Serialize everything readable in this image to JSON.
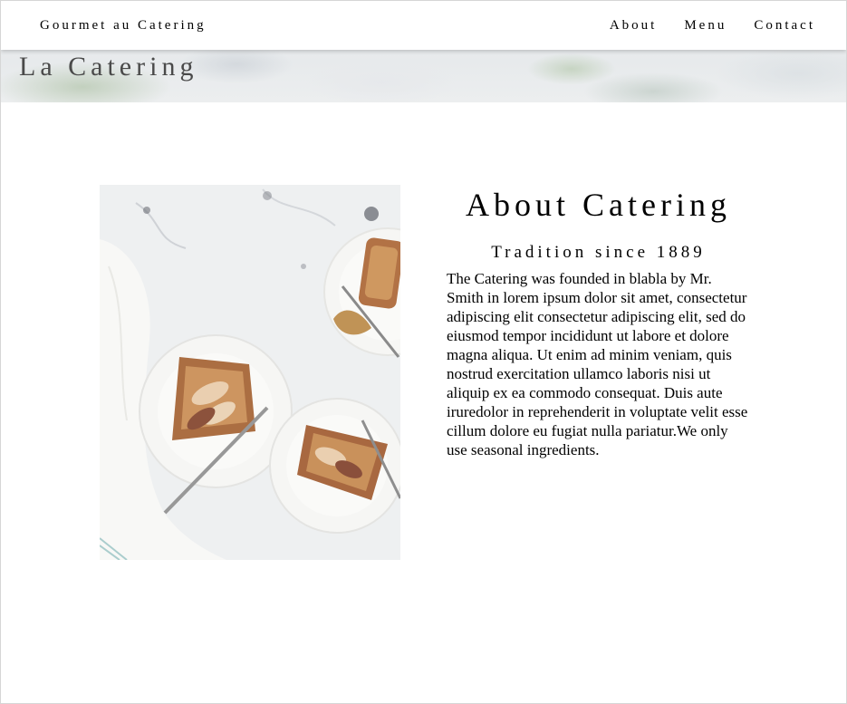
{
  "navbar": {
    "brand": "Gourmet au Catering",
    "links": [
      "About",
      "Menu",
      "Contact"
    ]
  },
  "hero": {
    "title": "La Catering"
  },
  "about": {
    "image_alt": "Tarts on plates",
    "heading": "About Catering",
    "subheading": "Tradition since 1889",
    "body": "The Catering was founded in blabla by Mr. Smith in lorem ipsum dolor sit amet, consectetur adipiscing elit consectetur adipiscing elit, sed do eiusmod tempor incididunt ut labore et dolore magna aliqua. Ut enim ad minim veniam, quis nostrud exercitation ullamco laboris nisi ut aliquip ex ea commodo consequat. Duis aute iruredolor in reprehenderit in voluptate velit esse cillum dolore eu fugiat nulla pariatur.We only use seasonal ingredients."
  },
  "colors": {
    "background": "#ffffff",
    "text": "#000000",
    "hero_title": "#4a4a4a"
  }
}
